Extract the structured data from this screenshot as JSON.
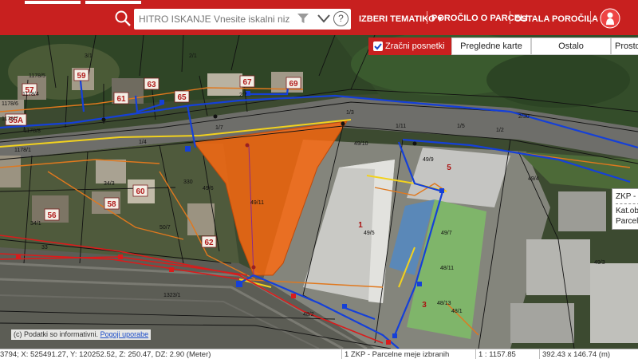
{
  "header": {
    "search_label": "HITRO ISKANJE",
    "search_placeholder": "Vnesite iskalni niz",
    "help_glyph": "?",
    "menu": {
      "tematiko": "IZBERI TEMATIKO",
      "porocilo": "POROČILO O PARCELI",
      "ostala": "OSTALA POROČILA"
    }
  },
  "layers": {
    "aerial": "Zračni posnetki",
    "overview": "Pregledne karte",
    "other": "Ostalo",
    "spatial": "Prosto"
  },
  "map": {
    "house_numbers": [
      "57",
      "59",
      "55A",
      "61",
      "63",
      "65",
      "67",
      "69",
      "60",
      "58",
      "56",
      "62",
      "5",
      "1",
      "3"
    ],
    "parcels": [
      "1178/5",
      "1178/4",
      "1178/6",
      "1178/7",
      "1178/8",
      "3/1",
      "2/1",
      "2/7",
      "1/3",
      "2/30",
      "1/7",
      "1/11",
      "1/5",
      "1/2",
      "49/10",
      "49/9",
      "49/6",
      "49/5",
      "49/7",
      "49/11",
      "48/11",
      "48/13",
      "48/2",
      "34/3",
      "34/1",
      "50/7",
      "330",
      "1323/1",
      "1178/1",
      "49/4",
      "49/3",
      "48/1",
      "33",
      "1/4"
    ],
    "colors": {
      "parcel_highlight": "#ff6a10",
      "boundary": "#111111",
      "line_blue": "#1540d8",
      "line_red": "#d91c1c",
      "line_yellow": "#f2d21e",
      "line_orange": "#e0781e",
      "header": "#c8201f"
    }
  },
  "tooltip": {
    "title": "ZKP - P",
    "line1": "Kat.obč",
    "line2": "Parcela"
  },
  "attribution": {
    "text": "(c) Podatki so informativni.",
    "link": "Pogoji uporabe"
  },
  "status": {
    "coords": "3794; X: 525491.27, Y: 120252.52, Z: 250.47, DZ: 2.90 (Meter)",
    "layer": "1 ZKP - Parcelne meje izbranih",
    "scale": "1 : 1157.85",
    "extent": "392.43 x 146.74 (m)"
  }
}
